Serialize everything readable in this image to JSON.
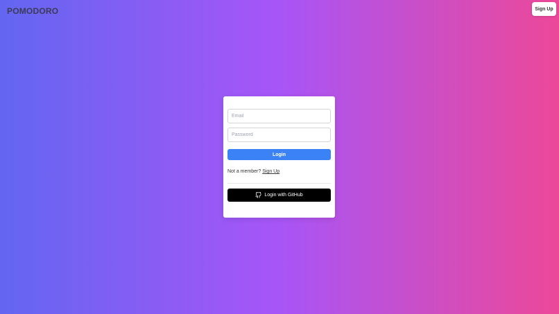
{
  "header": {
    "brand": "POMODORO",
    "signup_label": "Sign Up"
  },
  "form": {
    "email_placeholder": "Email",
    "email_value": "",
    "password_placeholder": "Password",
    "password_value": "",
    "login_label": "Login",
    "member_prompt": "Not a member?",
    "member_link": "Sign Up",
    "github_label": "Login with GitHub",
    "github_icon": "github-icon"
  },
  "colors": {
    "gradient_start": "#6366f1",
    "gradient_mid": "#a855f7",
    "gradient_end": "#ec4899",
    "login_button": "#3b82f6",
    "github_button": "#000000"
  }
}
